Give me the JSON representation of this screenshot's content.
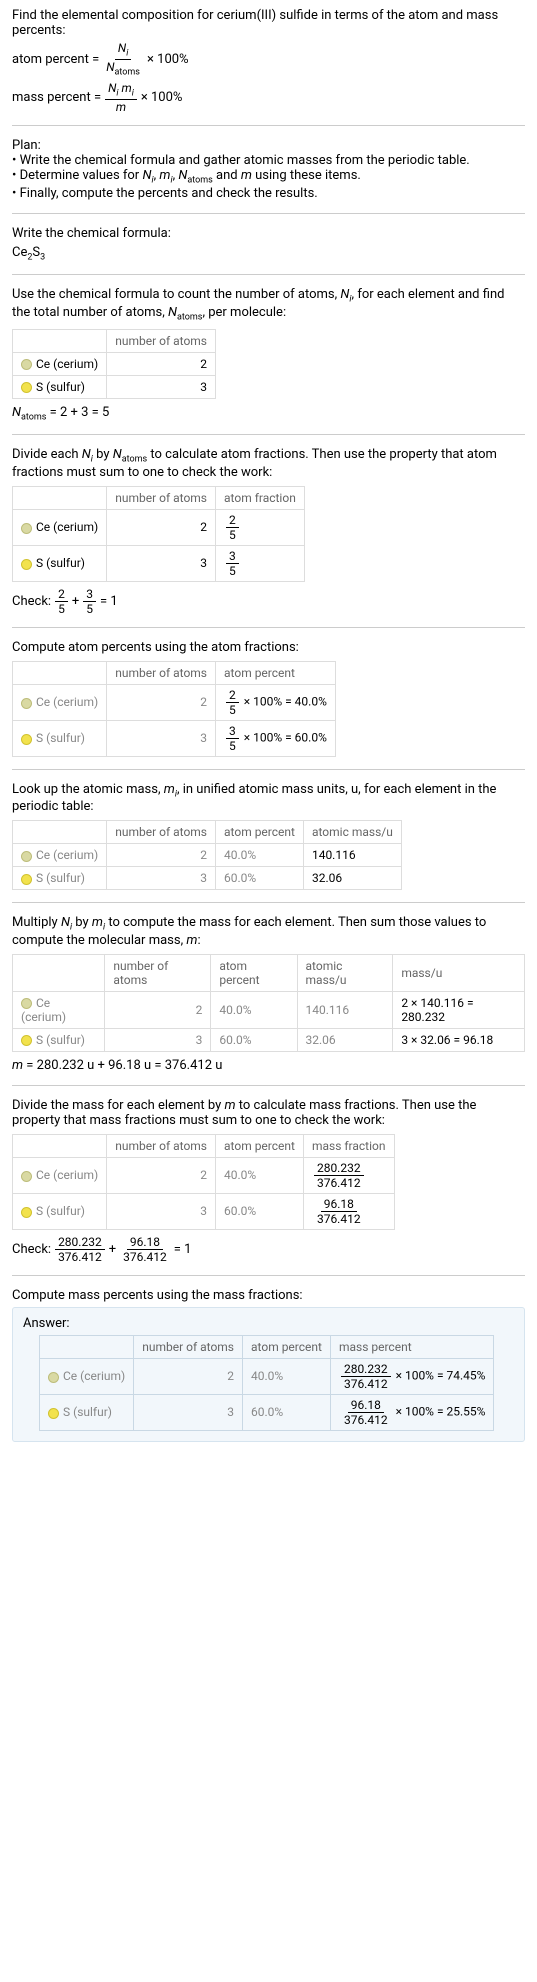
{
  "header": {
    "line1": "Find the elemental composition for cerium(III) sulfide in terms of the atom and mass percents:",
    "atomPercentLabel": "atom percent = ",
    "atomFrac_num": "N_i",
    "atomFrac_den": "N_atoms",
    "times100": " × 100%",
    "massPercentLabel": "mass percent = ",
    "massFrac_num": "N_i m_i",
    "massFrac_den": "m"
  },
  "plan": {
    "title": "Plan:",
    "b1": "• Write the chemical formula and gather atomic masses from the periodic table.",
    "b2_pre": "• Determine values for ",
    "b2_post": " using these items.",
    "b3": "• Finally, compute the percents and check the results."
  },
  "formula": {
    "title": "Write the chemical formula:",
    "chem": "Ce₂S₃"
  },
  "countAtoms": {
    "text_pre": "Use the chemical formula to count the number of atoms, ",
    "text_mid": ", for each element and find the total number of atoms, ",
    "text_post": ", per molecule:",
    "h_atoms": "number of atoms",
    "ce_label": "Ce (cerium)",
    "s_label": "S (sulfur)",
    "ce_n": "2",
    "s_n": "3",
    "sum_pre": "N",
    "sum_expr": " = 2 + 3 = 5"
  },
  "atomFractions": {
    "text": "Divide each N_i by N_atoms to calculate atom fractions. Then use the property that atom fractions must sum to one to check the work:",
    "h_atoms": "number of atoms",
    "h_frac": "atom fraction",
    "ce_n": "2",
    "s_n": "3",
    "ce_frac_num": "2",
    "ce_frac_den": "5",
    "s_frac_num": "3",
    "s_frac_den": "5",
    "check_pre": "Check: ",
    "check_post": " = 1"
  },
  "atomPercents": {
    "text": "Compute atom percents using the atom fractions:",
    "h_atoms": "number of atoms",
    "h_pct": "atom percent",
    "ce_n": "2",
    "s_n": "3",
    "ce_expr": " × 100% = 40.0%",
    "s_expr": " × 100% = 60.0%"
  },
  "atomicMass": {
    "text": "Look up the atomic mass, m_i, in unified atomic mass units, u, for each element in the periodic table:",
    "h_atoms": "number of atoms",
    "h_pct": "atom percent",
    "h_mass": "atomic mass/u",
    "ce_n": "2",
    "ce_pct": "40.0%",
    "ce_mass": "140.116",
    "s_n": "3",
    "s_pct": "60.0%",
    "s_mass": "32.06"
  },
  "molMass": {
    "text": "Multiply N_i by m_i to compute the mass for each element. Then sum those values to compute the molecular mass, m:",
    "h_atoms": "number of atoms",
    "h_pct": "atom percent",
    "h_mass": "atomic mass/u",
    "h_total": "mass/u",
    "ce_n": "2",
    "ce_pct": "40.0%",
    "ce_mass": "140.116",
    "ce_prod": "2 × 140.116 = 280.232",
    "s_n": "3",
    "s_pct": "60.0%",
    "s_mass": "32.06",
    "s_prod": "3 × 32.06 = 96.18",
    "sum": "m = 280.232 u + 96.18 u = 376.412 u"
  },
  "massFractions": {
    "text": "Divide the mass for each element by m to calculate mass fractions. Then use the property that mass fractions must sum to one to check the work:",
    "h_atoms": "number of atoms",
    "h_pct": "atom percent",
    "h_mfrac": "mass fraction",
    "ce_n": "2",
    "ce_pct": "40.0%",
    "ce_num": "280.232",
    "ce_den": "376.412",
    "s_n": "3",
    "s_pct": "60.0%",
    "s_num": "96.18",
    "s_den": "376.412",
    "check_pre": "Check: ",
    "check_post": " = 1"
  },
  "massPercents": {
    "text": "Compute mass percents using the mass fractions:"
  },
  "answer": {
    "title": "Answer:",
    "h_atoms": "number of atoms",
    "h_pct": "atom percent",
    "h_mpct": "mass percent",
    "ce_n": "2",
    "ce_pct": "40.0%",
    "ce_num": "280.232",
    "ce_den": "376.412",
    "ce_expr": " × 100% = 74.45%",
    "s_n": "3",
    "s_pct": "60.0%",
    "s_num": "96.18",
    "s_den": "376.412",
    "s_expr": " × 100% = 25.55%"
  },
  "labels": {
    "ce": "Ce (cerium)",
    "s": "S (sulfur)"
  }
}
